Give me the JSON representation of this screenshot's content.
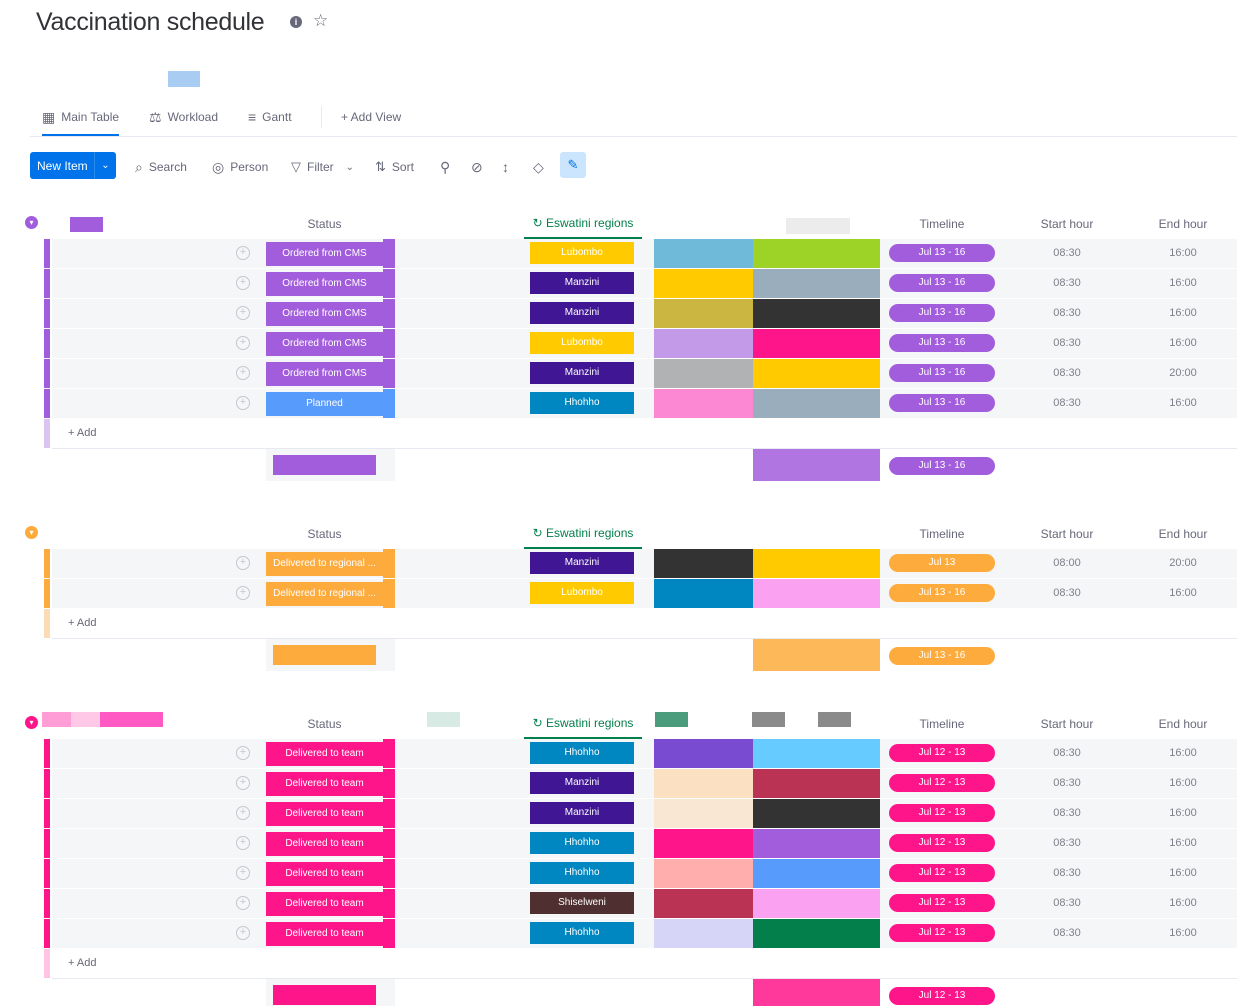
{
  "app": {
    "title": "Vaccination schedule",
    "info_icon": "info-icon",
    "star_icon": "star-icon"
  },
  "tabs": [
    {
      "label": "Main Table",
      "icon": "table-icon",
      "active": true
    },
    {
      "label": "Workload",
      "icon": "workload-icon",
      "active": false
    },
    {
      "label": "Gantt",
      "icon": "gantt-icon",
      "active": false
    },
    {
      "label": "+ Add View",
      "icon": "",
      "active": false
    }
  ],
  "toolbar": {
    "new_item": "New Item",
    "search": "Search",
    "person": "Person",
    "filter": "Filter",
    "sort": "Sort"
  },
  "columns": {
    "status": "Status",
    "regions": "Eswatini regions",
    "timeline": "Timeline",
    "start_hour": "Start hour",
    "end_hour": "End hour"
  },
  "add_label": "+ Add",
  "colors": {
    "purple": "#a25ddc",
    "orange": "#fdab3d",
    "pink": "#ff158a",
    "blue_status": "#579bfc",
    "region_purple": "#401694",
    "region_yellow": "#ffcb00",
    "region_blue": "#0086c0",
    "region_brown": "#4f2f2f"
  },
  "groups": [
    {
      "color": "#a25ddc",
      "summary_timeline": "Jul 13 - 16",
      "rows": [
        {
          "status": "Ordered from CMS",
          "status_color": "#a25ddc",
          "region": "Lubombo",
          "region_color": "#ffcb00",
          "timeline": "Jul 13 - 16",
          "start": "08:30",
          "end": "16:00"
        },
        {
          "status": "Ordered from CMS",
          "status_color": "#a25ddc",
          "region": "Manzini",
          "region_color": "#401694",
          "timeline": "Jul 13 - 16",
          "start": "08:30",
          "end": "16:00"
        },
        {
          "status": "Ordered from CMS",
          "status_color": "#a25ddc",
          "region": "Manzini",
          "region_color": "#401694",
          "timeline": "Jul 13 - 16",
          "start": "08:30",
          "end": "16:00"
        },
        {
          "status": "Ordered from CMS",
          "status_color": "#a25ddc",
          "region": "Lubombo",
          "region_color": "#ffcb00",
          "timeline": "Jul 13 - 16",
          "start": "08:30",
          "end": "16:00"
        },
        {
          "status": "Ordered from CMS",
          "status_color": "#a25ddc",
          "region": "Manzini",
          "region_color": "#401694",
          "timeline": "Jul 13 - 16",
          "start": "08:30",
          "end": "20:00"
        },
        {
          "status": "Planned",
          "status_color": "#579bfc",
          "region": "Hhohho",
          "region_color": "#0086c0",
          "timeline": "Jul 13 - 16",
          "start": "08:30",
          "end": "16:00"
        }
      ]
    },
    {
      "color": "#fdab3d",
      "summary_timeline": "Jul 13 - 16",
      "rows": [
        {
          "status": "Delivered to regional ...",
          "status_color": "#fdab3d",
          "region": "Manzini",
          "region_color": "#401694",
          "timeline": "Jul 13",
          "start": "08:00",
          "end": "20:00"
        },
        {
          "status": "Delivered to regional ...",
          "status_color": "#fdab3d",
          "region": "Lubombo",
          "region_color": "#ffcb00",
          "timeline": "Jul 13 - 16",
          "start": "08:30",
          "end": "16:00"
        }
      ]
    },
    {
      "color": "#ff158a",
      "summary_timeline": "Jul 12 - 13",
      "rows": [
        {
          "status": "Delivered to team",
          "status_color": "#ff158a",
          "region": "Hhohho",
          "region_color": "#0086c0",
          "timeline": "Jul 12 - 13",
          "start": "08:30",
          "end": "16:00"
        },
        {
          "status": "Delivered to team",
          "status_color": "#ff158a",
          "region": "Manzini",
          "region_color": "#401694",
          "timeline": "Jul 12 - 13",
          "start": "08:30",
          "end": "16:00"
        },
        {
          "status": "Delivered to team",
          "status_color": "#ff158a",
          "region": "Manzini",
          "region_color": "#401694",
          "timeline": "Jul 12 - 13",
          "start": "08:30",
          "end": "16:00"
        },
        {
          "status": "Delivered to team",
          "status_color": "#ff158a",
          "region": "Hhohho",
          "region_color": "#0086c0",
          "timeline": "Jul 12 - 13",
          "start": "08:30",
          "end": "16:00"
        },
        {
          "status": "Delivered to team",
          "status_color": "#ff158a",
          "region": "Hhohho",
          "region_color": "#0086c0",
          "timeline": "Jul 12 - 13",
          "start": "08:30",
          "end": "16:00"
        },
        {
          "status": "Delivered to team",
          "status_color": "#ff158a",
          "region": "Shiselweni",
          "region_color": "#4f2f2f",
          "timeline": "Jul 12 - 13",
          "start": "08:30",
          "end": "16:00"
        },
        {
          "status": "Delivered to team",
          "status_color": "#ff158a",
          "region": "Hhohho",
          "region_color": "#0086c0",
          "timeline": "Jul 12 - 13",
          "start": "08:30",
          "end": "16:00"
        }
      ]
    }
  ]
}
